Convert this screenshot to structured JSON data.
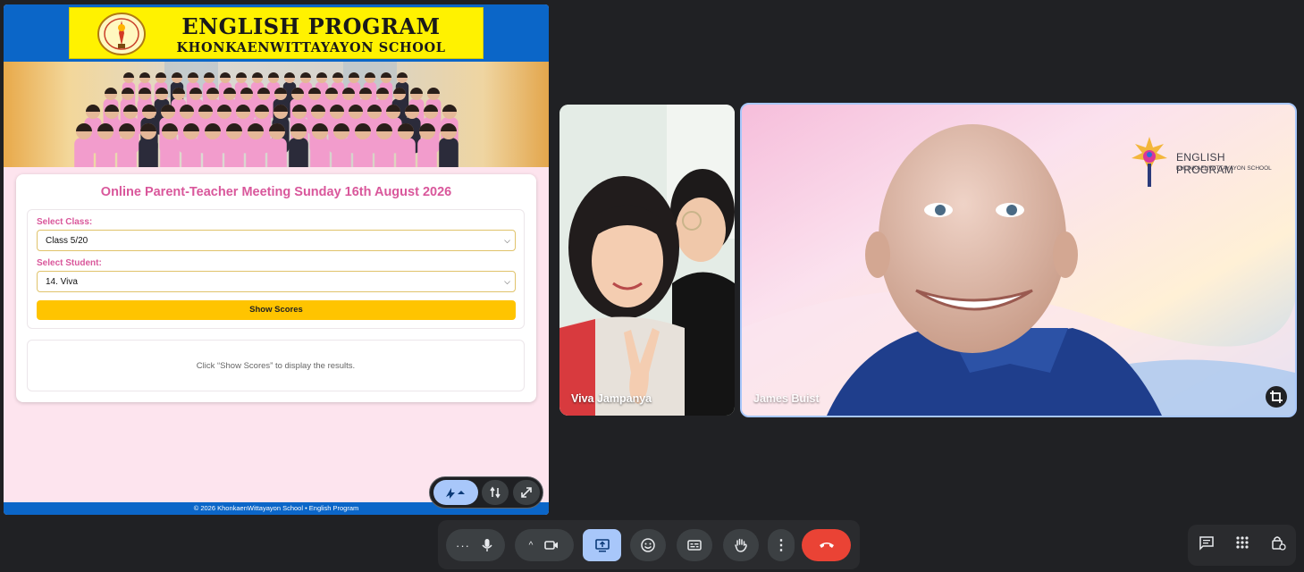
{
  "shared_screen": {
    "banner": {
      "title": "ENGLISH PROGRAM",
      "subtitle": "KHONKAENWITTAYAYON SCHOOL"
    },
    "meeting_title": "Online Parent-Teacher Meeting Sunday 16th August 2026",
    "class_field": {
      "label": "Select Class:",
      "value": "Class 5/20"
    },
    "student_field": {
      "label": "Select Student:",
      "value": "14. Viva"
    },
    "show_scores_label": "Show Scores",
    "results_placeholder": "Click “Show Scores” to display the results.",
    "footer": "© 2026 KhonkaenWittayayon School • English Program"
  },
  "participants": [
    {
      "name": "Viva Jampanya"
    },
    {
      "name": "James Buist"
    }
  ],
  "james_background": {
    "logo_title": "ENGLISH PROGRAM",
    "logo_subtitle": "KHONKAENWITTAYAYON SCHOOL"
  },
  "colors": {
    "accent_pink": "#d9579b",
    "button_yellow": "#ffc400",
    "header_blue": "#0b66c8",
    "end_call_red": "#ea4335",
    "present_active_blue": "#a8c7fa"
  },
  "toolbar_icons": [
    "more-options-icon",
    "microphone-icon",
    "chevron-up-icon",
    "camera-icon",
    "present-screen-icon",
    "emoji-icon",
    "captions-icon",
    "raise-hand-icon",
    "more-vert-icon",
    "end-call-icon"
  ],
  "side_icons": [
    "chat-icon",
    "activities-icon",
    "host-controls-icon"
  ]
}
